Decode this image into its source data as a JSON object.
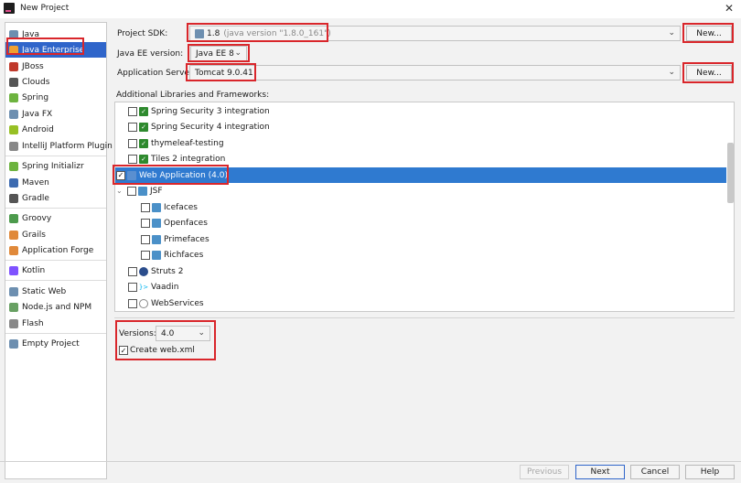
{
  "window": {
    "title": "New Project",
    "close_glyph": "✕"
  },
  "sidebar": {
    "items": [
      {
        "label": "Java",
        "icon": "folder-icon",
        "color": "#6d8fb0"
      },
      {
        "label": "Java Enterprise",
        "icon": "java-enterprise-icon",
        "color": "#f0a030",
        "selected": true
      },
      {
        "label": "JBoss",
        "icon": "jboss-icon",
        "color": "#c0392b"
      },
      {
        "label": "Clouds",
        "icon": "clouds-icon",
        "color": "#555555"
      },
      {
        "label": "Spring",
        "icon": "spring-icon",
        "color": "#6db33f"
      },
      {
        "label": "Java FX",
        "icon": "javafx-icon",
        "color": "#6d8fb0"
      },
      {
        "label": "Android",
        "icon": "android-icon",
        "color": "#97c024"
      },
      {
        "label": "IntelliJ Platform Plugin",
        "icon": "plugin-icon",
        "color": "#888888"
      },
      {
        "label": "Spring Initializr",
        "icon": "spring-initializr-icon",
        "color": "#6db33f"
      },
      {
        "label": "Maven",
        "icon": "maven-icon",
        "color": "#3d6bb0"
      },
      {
        "label": "Gradle",
        "icon": "gradle-icon",
        "color": "#555555"
      },
      {
        "label": "Groovy",
        "icon": "groovy-icon",
        "color": "#4c9a4c"
      },
      {
        "label": "Grails",
        "icon": "grails-icon",
        "color": "#e0893a"
      },
      {
        "label": "Application Forge",
        "icon": "application-forge-icon",
        "color": "#e0893a"
      },
      {
        "label": "Kotlin",
        "icon": "kotlin-icon",
        "color": "#7f52ff"
      },
      {
        "label": "Static Web",
        "icon": "static-web-icon",
        "color": "#6d8fb0"
      },
      {
        "label": "Node.js and NPM",
        "icon": "nodejs-icon",
        "color": "#68a063"
      },
      {
        "label": "Flash",
        "icon": "flash-icon",
        "color": "#888888"
      },
      {
        "label": "Empty Project",
        "icon": "empty-project-icon",
        "color": "#6d8fb0"
      }
    ]
  },
  "settings": {
    "sdk_label": "Project SDK:",
    "sdk_value": "1.8",
    "sdk_detail": "(java version \"1.8.0_161\")",
    "ee_label": "Java EE version:",
    "ee_value": "Java EE 8",
    "server_label": "Application Server:",
    "server_value": "Tomcat 9.0.41",
    "new_button": "New...",
    "libs_label": "Additional Libraries and Frameworks:"
  },
  "frameworks": [
    {
      "label": "Spring Security 3 integration",
      "checked": false,
      "icon": "green-check-icon"
    },
    {
      "label": "Spring Security 4 integration",
      "checked": false,
      "icon": "green-check-icon"
    },
    {
      "label": "thymeleaf-testing",
      "checked": false,
      "icon": "green-check-icon"
    },
    {
      "label": "Tiles 2 integration",
      "checked": false,
      "icon": "green-check-icon"
    },
    {
      "label": "Web Application (4.0)",
      "checked": true,
      "icon": "web-app-icon",
      "selected": true
    },
    {
      "label": "JSF",
      "checked": false,
      "icon": "jsf-icon",
      "expandable": true
    },
    {
      "label": "Icefaces",
      "checked": false,
      "icon": "jsf-icon"
    },
    {
      "label": "Openfaces",
      "checked": false,
      "icon": "jsf-icon"
    },
    {
      "label": "Primefaces",
      "checked": false,
      "icon": "jsf-icon"
    },
    {
      "label": "Richfaces",
      "checked": false,
      "icon": "jsf-icon"
    },
    {
      "label": "Struts 2",
      "checked": false,
      "icon": "struts-icon"
    },
    {
      "label": "Vaadin",
      "checked": false,
      "icon": "vaadin-icon"
    },
    {
      "label": "WebServices",
      "checked": false,
      "icon": "globe-icon"
    }
  ],
  "options": {
    "versions_label": "Versions:",
    "versions_value": "4.0",
    "create_web_xml": "Create web.xml",
    "create_web_xml_checked": true
  },
  "footer": {
    "previous": "Previous",
    "next": "Next",
    "cancel": "Cancel",
    "help": "Help"
  },
  "colors": {
    "selection": "#2f7ad0",
    "sidebar_selection": "#2f65ca",
    "highlight_box": "#d9262b"
  }
}
